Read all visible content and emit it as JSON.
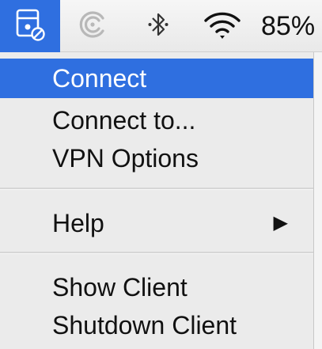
{
  "menubar": {
    "items": [
      {
        "icon": "vpn-lock-icon"
      },
      {
        "icon": "sync-icon"
      },
      {
        "icon": "bluetooth-icon"
      },
      {
        "icon": "wifi-icon"
      }
    ],
    "battery_percent": "85%"
  },
  "menu": {
    "items": [
      {
        "label": "Connect",
        "highlighted": true
      },
      {
        "label": "Connect to..."
      },
      {
        "label": "VPN Options"
      },
      {
        "label": "Help",
        "submenu_arrow": "▶"
      },
      {
        "label": "Show Client"
      },
      {
        "label": "Shutdown Client"
      }
    ]
  },
  "colors": {
    "highlight": "#2f6fe0",
    "menu_background": "#ebebeb",
    "text": "#111111"
  }
}
